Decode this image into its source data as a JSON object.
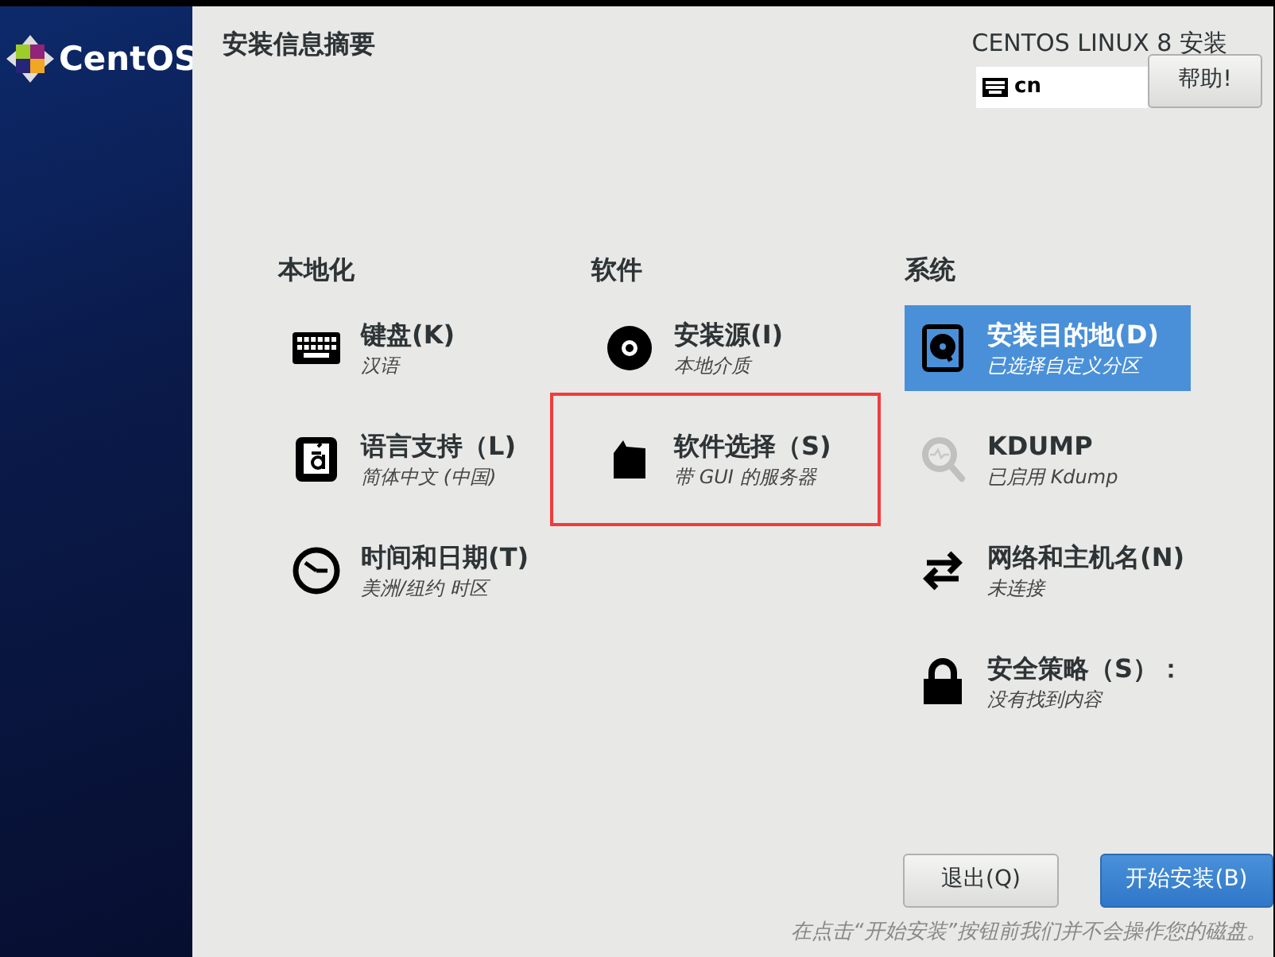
{
  "sidebar": {
    "logo_text": "CentOS"
  },
  "header": {
    "title": "安装信息摘要",
    "product": "CENTOS LINUX 8 安装",
    "keyboard_layout": "cn",
    "help_button": "帮助!"
  },
  "categories": [
    {
      "heading": "本地化",
      "items": [
        {
          "kind": "keyboard",
          "title": "键盘(K)",
          "status": "汉语",
          "selected": false,
          "highlighted": false
        },
        {
          "kind": "language",
          "title": "语言支持（L)",
          "status": "简体中文 (中国)",
          "selected": false,
          "highlighted": false
        },
        {
          "kind": "clock",
          "title": "时间和日期(T)",
          "status": "美洲/纽约 时区",
          "selected": false,
          "highlighted": false
        }
      ]
    },
    {
      "heading": "软件",
      "items": [
        {
          "kind": "disc",
          "title": "安装源(I)",
          "status": "本地介质",
          "selected": false,
          "highlighted": false
        },
        {
          "kind": "package",
          "title": "软件选择（S)",
          "status": "带 GUI 的服务器",
          "selected": false,
          "highlighted": true
        }
      ]
    },
    {
      "heading": "系统",
      "items": [
        {
          "kind": "disk",
          "title": "安装目的地(D)",
          "status": "已选择自定义分区",
          "selected": true,
          "highlighted": false
        },
        {
          "kind": "kdump",
          "title": "KDUMP",
          "status": "已启用 Kdump",
          "selected": false,
          "highlighted": false
        },
        {
          "kind": "network",
          "title": "网络和主机名(N)",
          "status": "未连接",
          "selected": false,
          "highlighted": false
        },
        {
          "kind": "lock",
          "title": "安全策略（S）：",
          "status": "没有找到内容",
          "selected": false,
          "highlighted": false
        }
      ]
    }
  ],
  "footer": {
    "buttons": [
      {
        "label": "退出(Q)",
        "kind": "secondary"
      },
      {
        "label": "开始安装(B)",
        "kind": "primary"
      }
    ],
    "note": "在点击“开始安装”按钮前我们并不会操作您的磁盘。"
  }
}
